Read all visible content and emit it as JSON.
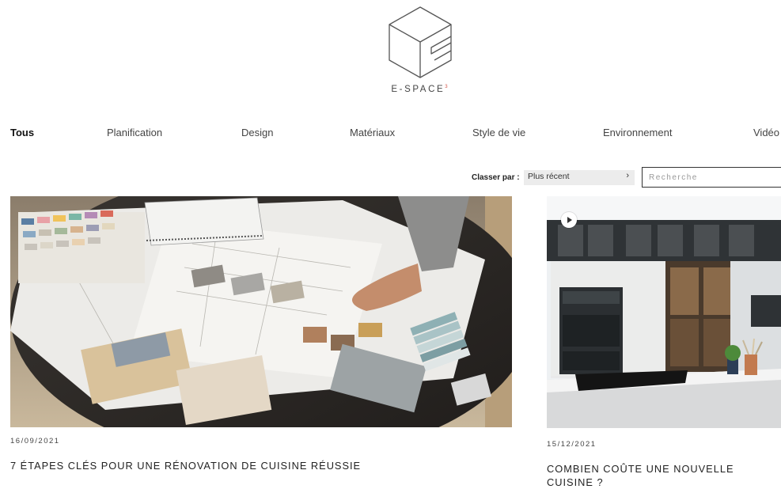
{
  "brand": {
    "name": "E-SPACE",
    "superscript": "3"
  },
  "nav": {
    "items": [
      {
        "label": "Tous",
        "active": true
      },
      {
        "label": "Planification",
        "active": false
      },
      {
        "label": "Design",
        "active": false
      },
      {
        "label": "Matériaux",
        "active": false
      },
      {
        "label": "Style de vie",
        "active": false
      },
      {
        "label": "Environnement",
        "active": false
      },
      {
        "label": "Vidéo",
        "active": false
      }
    ]
  },
  "sort": {
    "label": "Classer par :",
    "value": "Plus récent",
    "chevron": "›"
  },
  "search": {
    "placeholder": "Recherche"
  },
  "posts": [
    {
      "date": "16/09/2021",
      "title": "7 ÉTAPES CLÉS POUR UNE RÉNOVATION DE CUISINE RÉUSSIE",
      "image": "design-materials-photo"
    },
    {
      "date": "15/12/2021",
      "title_line1": "COMBIEN COÛTE UNE NOUVELLE",
      "title_line2": "CUISINE ?",
      "image": "kitchen-video-thumbnail",
      "icon": "play-icon"
    }
  ],
  "colors": {
    "accent": "#d4574b",
    "text": "#222222",
    "sort_bg": "#ececec"
  }
}
